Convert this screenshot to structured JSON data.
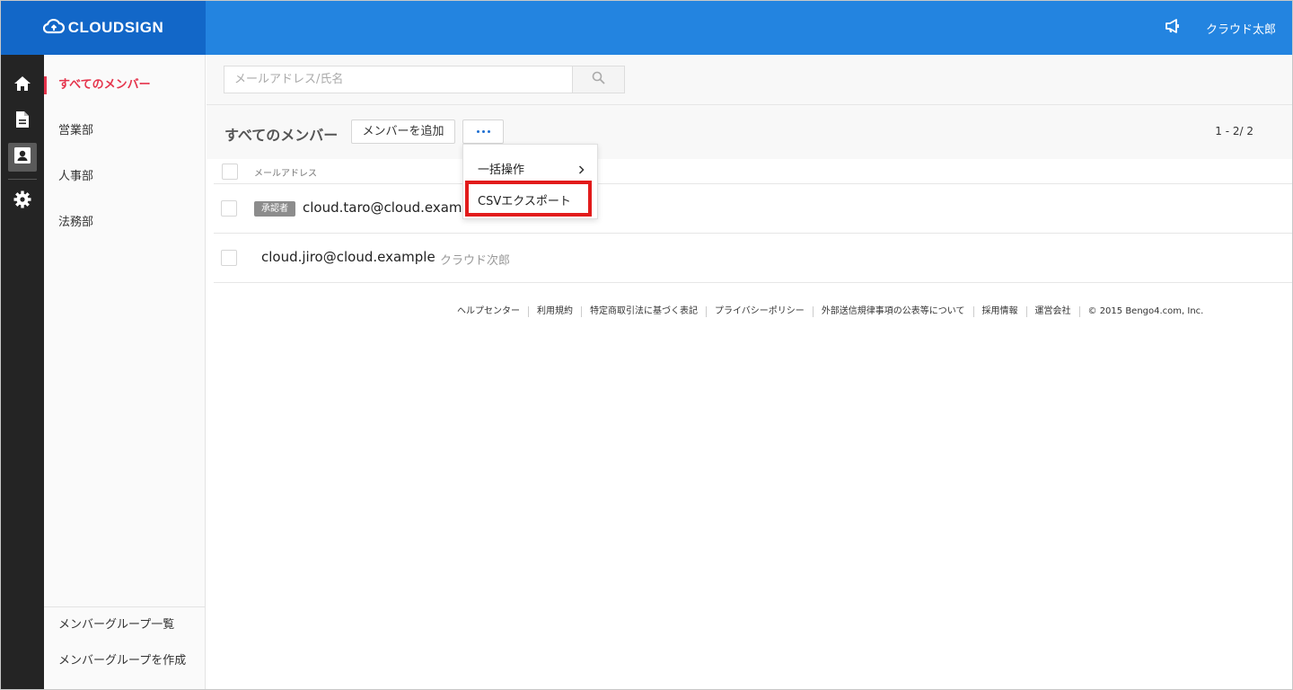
{
  "header": {
    "brand": "CLOUDSIGN",
    "user_name": "クラウド太郎",
    "icons": {
      "brand": "cloud-logo-icon",
      "announcement": "megaphone-icon"
    },
    "colors": {
      "header_bg": "#2384e0",
      "brand_bg": "#1267c8",
      "accent_red": "#e5334b"
    }
  },
  "rail": {
    "items": [
      {
        "icon": "home-icon"
      },
      {
        "icon": "document-icon"
      },
      {
        "icon": "contact-card-icon",
        "active": true
      },
      {
        "icon": "gear-icon"
      }
    ]
  },
  "groups": {
    "items": [
      {
        "label": "すべてのメンバー",
        "active": true
      },
      {
        "label": "営業部"
      },
      {
        "label": "人事部"
      },
      {
        "label": "法務部"
      }
    ],
    "bottom": {
      "list_label": "メンバーグループ一覧",
      "create_label": "メンバーグループを作成"
    }
  },
  "search": {
    "placeholder": "メールアドレス/氏名"
  },
  "toolbar": {
    "title": "すべてのメンバー",
    "add_label": "メンバーを追加",
    "pagination": "1 - 2/ 2"
  },
  "table": {
    "email_header": "メールアドレス",
    "rows": [
      {
        "badge": "承認者",
        "email": "cloud.taro@cloud.examp",
        "name": ""
      },
      {
        "badge": "",
        "email": "cloud.jiro@cloud.example",
        "name": "クラウド次郎"
      }
    ]
  },
  "dropdown": {
    "bulk_label": "一括操作",
    "csv_label": "CSVエクスポート"
  },
  "footer": {
    "links": [
      "ヘルプセンター",
      "利用規約",
      "特定商取引法に基づく表記",
      "プライバシーポリシー",
      "外部送信規律事項の公表等について",
      "採用情報",
      "運営会社"
    ],
    "copyright": "© 2015 Bengo4.com, Inc."
  }
}
